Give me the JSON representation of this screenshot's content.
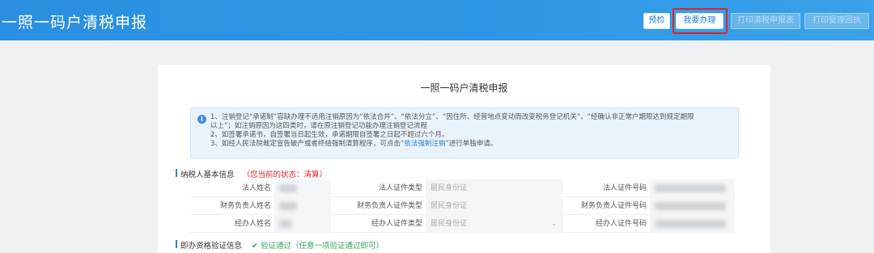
{
  "header": {
    "title": "一照一码户清税申报",
    "buttons": {
      "preview": "预检",
      "declare": "我要办理",
      "print1": "打印清税申报表",
      "print2": "打印受理回执"
    }
  },
  "card": {
    "title": "一照一码户清税申报",
    "notice": {
      "icon": "info-icon",
      "line1": "1、注销登记“承诺制”容缺办理不适用注销原因为“依法合并”、“依法分立”、“因住所、经营地点变动而改变税务登记机关”、“经确认非正常户期限达到规定期限",
      "line2": "以上”；如注销原因为这四类时，请在原注销登记功能办理注销登记流程",
      "line3": "2、如签署承诺书，自签署当日起生效，承诺期限自签署之日起不超过六个月。",
      "line4_prefix": "3、如经人民法院裁定宣告破产或者终结强制清算程序，可点击“",
      "line4_link": "依法强制注销",
      "line4_suffix": "”进行单独申请。"
    },
    "taxpayer": {
      "heading": "纳税人基本信息",
      "status": "（您当前的状态：清算）",
      "rows": [
        {
          "l1": "法人姓名",
          "l2": "法人证件类型",
          "v2": "居民身份证",
          "l3": "法人证件号码"
        },
        {
          "l1": "财务负责人姓名",
          "l2": "财务负责人证件类型",
          "v2": "居民身份证",
          "l3": "财务负责人证件号码"
        },
        {
          "l1": "经办人姓名",
          "l2": "经办人证件类型",
          "v2": "居民身份证",
          "l3": "经办人证件号码"
        }
      ]
    },
    "verification": {
      "heading": "即办资格验证信息",
      "status": "验证通过（任意一项验证通过即可）"
    }
  }
}
